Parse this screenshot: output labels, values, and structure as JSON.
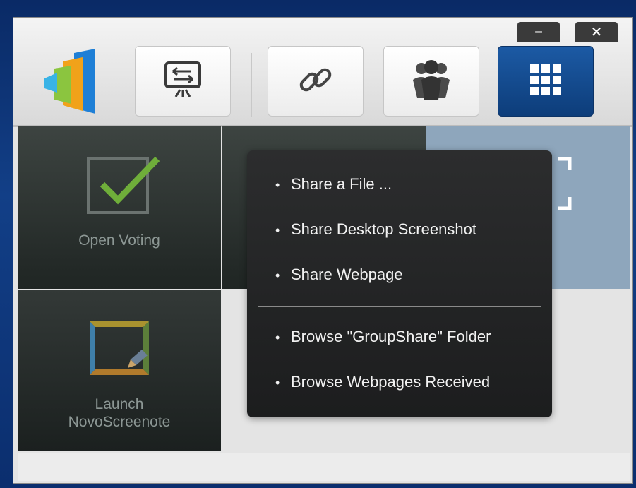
{
  "window": {
    "minimize_label": "–",
    "close_label": "✕"
  },
  "toolbar": {
    "buttons": [
      {
        "name": "screen-share",
        "icon": "screen-share-icon"
      },
      {
        "name": "link",
        "icon": "link-icon"
      },
      {
        "name": "group",
        "icon": "group-icon"
      },
      {
        "name": "apps",
        "icon": "apps-grid-icon",
        "active": true
      }
    ]
  },
  "tiles": {
    "voting_label": "Open Voting",
    "novo_label_line1": "Launch",
    "novo_label_line2": "NovoScreenote"
  },
  "menu": {
    "items": [
      {
        "label": "Share a File ..."
      },
      {
        "label": "Share Desktop Screenshot"
      },
      {
        "label": "Share Webpage"
      },
      {
        "label": "Browse \"GroupShare\" Folder"
      },
      {
        "label": "Browse Webpages Received"
      }
    ],
    "bullet": "•"
  },
  "colors": {
    "desktop": "#123f87",
    "accent": "#1c5aa4",
    "menu_bg": "#2c2d2e",
    "checkmark": "#6fae3a"
  }
}
